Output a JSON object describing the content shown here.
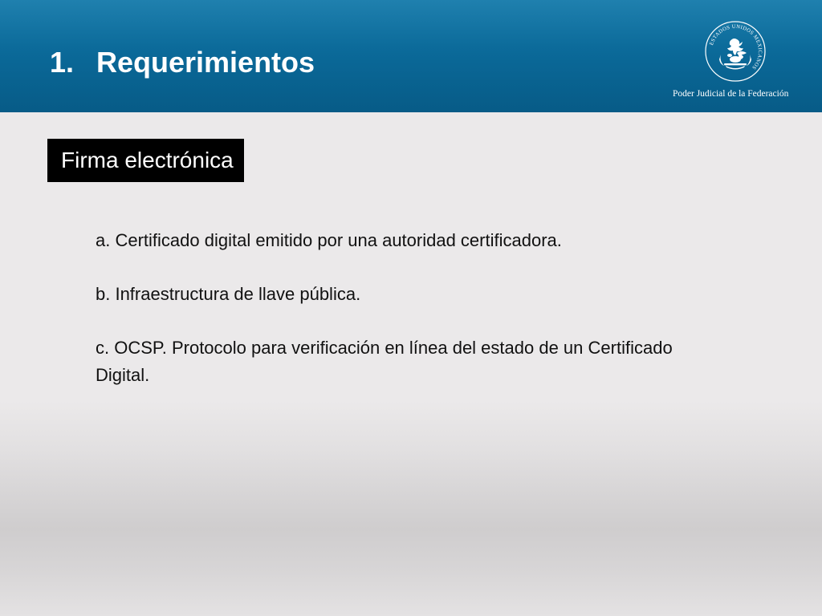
{
  "header": {
    "title_number": "1.",
    "title_text": "Requerimientos",
    "org_name": "Poder Judicial de la Federación",
    "seal_text": "ESTADOS UNIDOS MEXICANOS",
    "colors": {
      "header_blue": "#0a6796",
      "text_white": "#ffffff"
    }
  },
  "section": {
    "label": "Firma electrónica",
    "badge_color": "#000000"
  },
  "requirements": [
    "a. Certificado digital emitido por una autoridad certificadora.",
    "b. Infraestructura de llave pública.",
    "c. OCSP. Protocolo para verificación en línea del estado de un Certificado Digital."
  ],
  "icons": {
    "seal": "coat-of-arms-icon"
  }
}
